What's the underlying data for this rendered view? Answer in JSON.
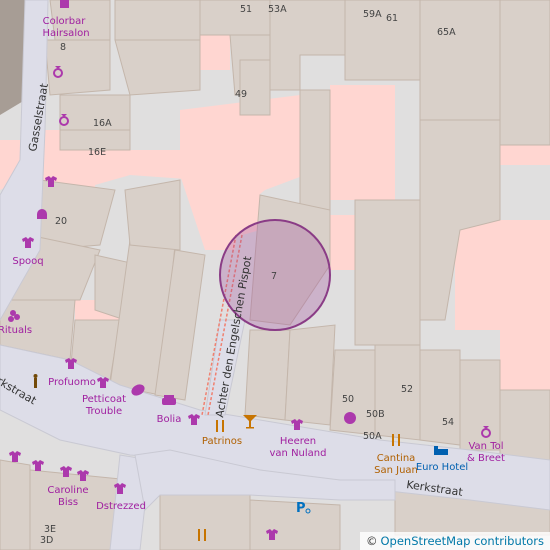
{
  "map": {
    "streets": [
      "Gasselstraat",
      "Achter den Engelschen Pispot",
      "Kerkstraat",
      "rkstraat"
    ],
    "house_numbers": [
      "51",
      "53A",
      "59A",
      "61",
      "65A",
      "8",
      "49",
      "16A",
      "16E",
      "20",
      "7",
      "50",
      "52",
      "50B",
      "50A",
      "54",
      "3E",
      "3D"
    ],
    "pois": {
      "colorbar": "Colorbar Hairsalon",
      "spooq": "Spooq",
      "rituals": "Rituals",
      "profuomo": "Profuomo",
      "petticoat": "Petticoat Trouble",
      "bolia": "Bolia",
      "patrinos": "Patrinos",
      "heeren": "Heeren van Nuland",
      "cantina": "Cantina San Juan",
      "euro_hotel": "Euro Hotel",
      "vantol": "Van Tol & Breet",
      "caroline": "Caroline Biss",
      "dstrezzed": "Dstrezzed"
    },
    "colors": {
      "land": "#e0dfdf",
      "building": "#d9d0c9",
      "building_stroke": "#c4b6ab",
      "pedestrian": "#dddde8",
      "retail": "#ffd6d1",
      "poi": "#ac39ac",
      "food": "#c77400",
      "marker": "#a04b9a"
    }
  },
  "attribution": {
    "copyright": "©",
    "link": "OpenStreetMap contributors"
  }
}
